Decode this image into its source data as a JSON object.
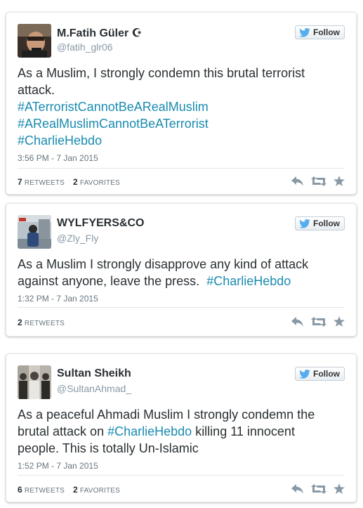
{
  "tweets": [
    {
      "name": "M.Fatih Güler",
      "name_badge": "☪",
      "handle": "@fatih_glr06",
      "follow_label": "Follow",
      "lines": [
        {
          "text": "As a Muslim, I strongly condemn this brutal terrorist"
        },
        {
          "text": "attack."
        },
        {
          "hashtag": "#ATerroristCannotBeARealMuslim"
        },
        {
          "hashtag": "#ARealMuslimCannotBeATerrorist"
        },
        {
          "hashtag": "#CharlieHebdo"
        }
      ],
      "timestamp": "3:56 PM - 7 Jan 2015",
      "retweets": "7",
      "retweets_label": "RETWEETS",
      "favorites": "2",
      "favorites_label": "FAVORITES"
    },
    {
      "name": "WYLFYERS&CO",
      "handle": "@Zly_Fly",
      "follow_label": "Follow",
      "lines": [
        {
          "text": "As a Muslim I strongly disapprove any kind of attack"
        },
        {
          "text": "against anyone, leave the press.",
          "hashtag": "#CharlieHebdo"
        }
      ],
      "timestamp": "1:32 PM - 7 Jan 2015",
      "retweets": "2",
      "retweets_label": "RETWEETS"
    },
    {
      "name": "Sultan Sheikh",
      "handle": "@SultanAhmad_",
      "follow_label": "Follow",
      "lines": [
        {
          "text": "As a peaceful Ahmadi Muslim I strongly condemn the"
        },
        {
          "text": "brutal attack on",
          "hashtag": "#CharlieHebdo",
          "after": "killing 11 innocent"
        },
        {
          "text": "people. This is totally Un-Islamic"
        }
      ],
      "timestamp": "1:52 PM - 7 Jan 2015",
      "retweets": "6",
      "retweets_label": "RETWEETS",
      "favorites": "2",
      "favorites_label": "FAVORITES"
    }
  ],
  "icons": {
    "follow": "twitter-bird-icon",
    "reply": "reply-icon",
    "retweet": "retweet-icon",
    "favorite": "star-icon"
  },
  "colors": {
    "hashtag": "#1a8bb0",
    "meta": "#66757f",
    "twitter_blue": "#55acee"
  }
}
